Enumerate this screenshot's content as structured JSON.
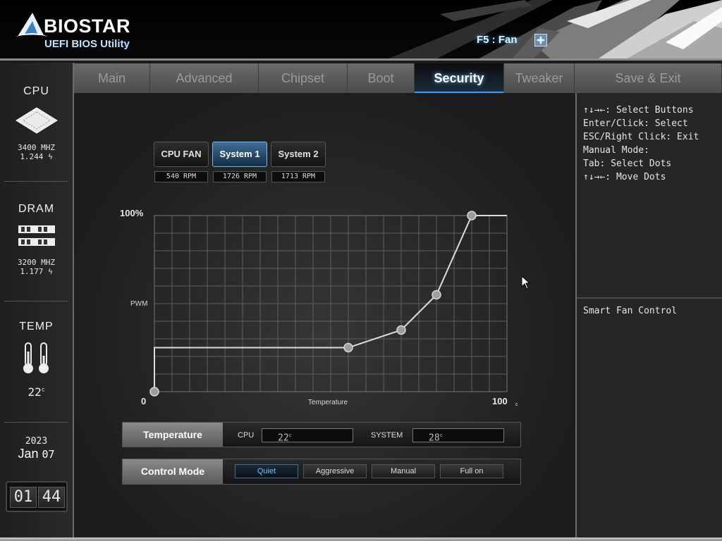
{
  "header": {
    "brand": "BIOSTAR",
    "subtitle": "UEFI BIOS Utility",
    "fan_hint": "F5 : Fan",
    "fan_icon": "fan-icon"
  },
  "sidebar": {
    "cpu": {
      "title": "CPU",
      "freq": "3400 MHZ",
      "volt": "1.244",
      "icon": "cpu-chip-icon"
    },
    "dram": {
      "title": "DRAM",
      "freq": "3200 MHZ",
      "volt": "1.177",
      "icon": "memory-module-icon"
    },
    "temp": {
      "title": "TEMP",
      "value": "22",
      "unit": "c",
      "icon": "thermometer-icon"
    },
    "date": {
      "year": "2023",
      "month": "Jan",
      "day": "07"
    },
    "clock": {
      "hour": "01",
      "minute": "44"
    }
  },
  "tabs": [
    {
      "label": "Main",
      "active": false
    },
    {
      "label": "Advanced",
      "active": false
    },
    {
      "label": "Chipset",
      "active": false
    },
    {
      "label": "Boot",
      "active": false
    },
    {
      "label": "Security",
      "active": true
    },
    {
      "label": "Tweaker",
      "active": false
    },
    {
      "label": "Save & Exit",
      "active": false
    }
  ],
  "fans": [
    {
      "label": "CPU FAN",
      "rpm": "540 RPM",
      "active": false
    },
    {
      "label": "System 1",
      "rpm": "1726 RPM",
      "active": true
    },
    {
      "label": "System 2",
      "rpm": "1713 RPM",
      "active": false
    }
  ],
  "chart_data": {
    "type": "line",
    "xlabel": "Temperature",
    "ylabel": "PWM",
    "x_min_label": "0",
    "x_max_label": "100",
    "x_unit": "c",
    "y_max_label": "100%",
    "xlim": [
      0,
      100
    ],
    "ylim": [
      0,
      100
    ],
    "grid": true,
    "series": [
      {
        "x": [
          0,
          0,
          55,
          70,
          80,
          90,
          100
        ],
        "y": [
          0,
          25,
          25,
          35,
          55,
          100,
          100
        ]
      }
    ],
    "control_points": [
      {
        "x": 0,
        "y": 0
      },
      {
        "x": 55,
        "y": 25
      },
      {
        "x": 70,
        "y": 35
      },
      {
        "x": 80,
        "y": 55
      },
      {
        "x": 90,
        "y": 100
      }
    ]
  },
  "temperature": {
    "label": "Temperature",
    "cpu_label": "CPU",
    "cpu_value": "22",
    "system_label": "SYSTEM",
    "system_value": "28",
    "unit": "c"
  },
  "control_mode": {
    "label": "Control Mode",
    "options": [
      "Quiet",
      "Aggressive",
      "Manual",
      "Full on"
    ],
    "selected": "Quiet"
  },
  "help": {
    "lines": [
      "↑↓→←: Select Buttons",
      "Enter/Click: Select",
      "ESC/Right Click: Exit",
      "Manual Mode:",
      "Tab: Select Dots",
      "↑↓→←: Move Dots"
    ],
    "description": "Smart Fan Control"
  },
  "colors": {
    "accent": "#3aa0ff",
    "active_tab_text": "#ffffff",
    "inactive_tab_text": "#9a9a9a",
    "quiet_active": "#6ec1ff"
  }
}
